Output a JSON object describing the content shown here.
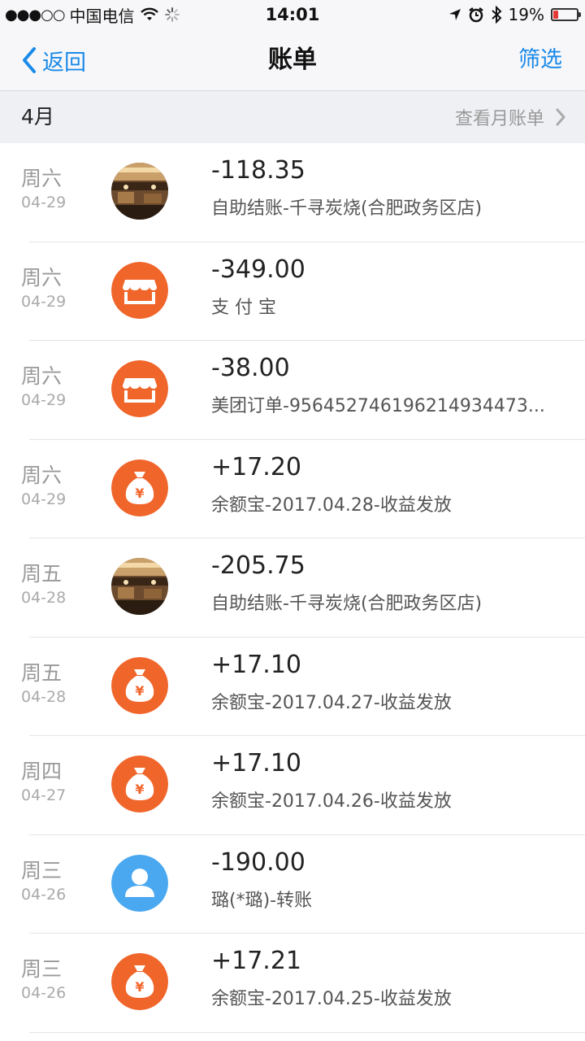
{
  "status_bar": {
    "signal_dots": "●●●○○",
    "carrier": "中国电信",
    "wifi_icon": "wifi-icon",
    "time": "14:01",
    "battery_text": "19%",
    "battery_level": 0.19
  },
  "nav": {
    "back_label": "返回",
    "title": "账单",
    "filter_label": "筛选"
  },
  "month": {
    "label": "4月",
    "view_bill_label": "查看月账单"
  },
  "colors": {
    "accent": "#1a8ae8",
    "merchant_orange": "#f0652a",
    "contact_blue": "#4aa8f0",
    "battery_red": "#e53935"
  },
  "transactions": [
    {
      "day": "周六",
      "date": "04-29",
      "icon": "restaurant-photo",
      "amount": "-118.35",
      "desc": "自助结账-千寻炭烧(合肥政务区店)"
    },
    {
      "day": "周六",
      "date": "04-29",
      "icon": "shop-icon",
      "amount": "-349.00",
      "desc": "支 付 宝"
    },
    {
      "day": "周六",
      "date": "04-29",
      "icon": "shop-icon",
      "amount": "-38.00",
      "desc": "美团订单-95645274619621493447​3..."
    },
    {
      "day": "周六",
      "date": "04-29",
      "icon": "money-bag-icon",
      "amount": "+17.20",
      "desc": "余额宝-2017.04.28-收益发放"
    },
    {
      "day": "周五",
      "date": "04-28",
      "icon": "restaurant-photo",
      "amount": "-205.75",
      "desc": "自助结账-千寻炭烧(合肥政务区店)"
    },
    {
      "day": "周五",
      "date": "04-28",
      "icon": "money-bag-icon",
      "amount": "+17.10",
      "desc": "余额宝-2017.04.27-收益发放"
    },
    {
      "day": "周四",
      "date": "04-27",
      "icon": "money-bag-icon",
      "amount": "+17.10",
      "desc": "余额宝-2017.04.26-收益发放"
    },
    {
      "day": "周三",
      "date": "04-26",
      "icon": "person-icon",
      "amount": "-190.00",
      "desc": "璐(*璐)-转账"
    },
    {
      "day": "周三",
      "date": "04-26",
      "icon": "money-bag-icon",
      "amount": "+17.21",
      "desc": "余额宝-2017.04.25-收益发放"
    }
  ]
}
